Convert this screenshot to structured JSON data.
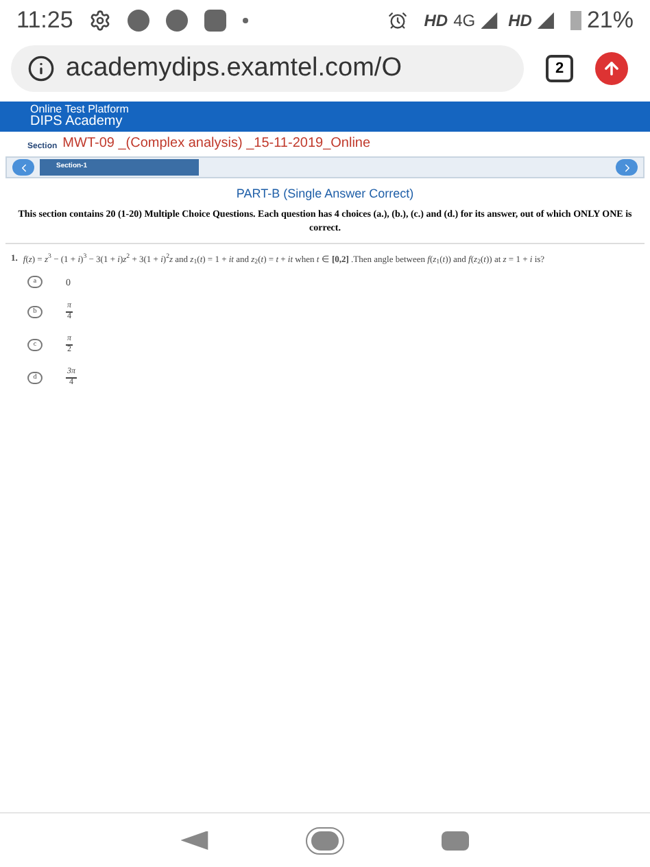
{
  "status_bar": {
    "time": "11:25",
    "network": "HD",
    "network_type": "4G",
    "network2": "HD",
    "battery": "21%"
  },
  "browser": {
    "url": "academydips.examtel.com/O",
    "tab_count": "2"
  },
  "header": {
    "subtitle": "Online Test Platform",
    "title": "DIPS Academy"
  },
  "section_label": "Section",
  "test_title": "MWT-09 _(Complex analysis) _15-11-2019_Online",
  "section_tabs": [
    {
      "label": "Section-1",
      "selected": true
    }
  ],
  "part_title": "PART-B (Single Answer Correct)",
  "instructions": "This section contains 20 (1-20) Multiple Choice Questions. Each question has 4 choices (a.), (b.), (c.) and (d.) for its answer, out of which ONLY ONE is correct.",
  "question": {
    "number": "1.",
    "text": "*f*(*z*) = *z*$^{3}$ − (1 + *i*)$^{3}$ − 3(1 + *i*)*z*$^{2}$ + 3(1 + *i*)$^{2}$*z*   and  *z*$_{1}$(*t*) = 1 + *it* and *z*$_{2}$(*t*) = *t* + *it* when *t* ∈ **[0,2]** .Then angle between *f*(*z*$_{1}$(*t*)) and *f*(*z*$_{2}$(*t*)) at *z* = 1 + *i* is?",
    "options": [
      {
        "label": "a",
        "kind": "plain",
        "value": "0"
      },
      {
        "label": "b",
        "kind": "fraction",
        "numerator": "π",
        "denominator": "4"
      },
      {
        "label": "c",
        "kind": "fraction",
        "numerator": "π",
        "denominator": "2"
      },
      {
        "label": "d",
        "kind": "fraction",
        "numerator": "3π",
        "denominator": "4"
      }
    ]
  }
}
